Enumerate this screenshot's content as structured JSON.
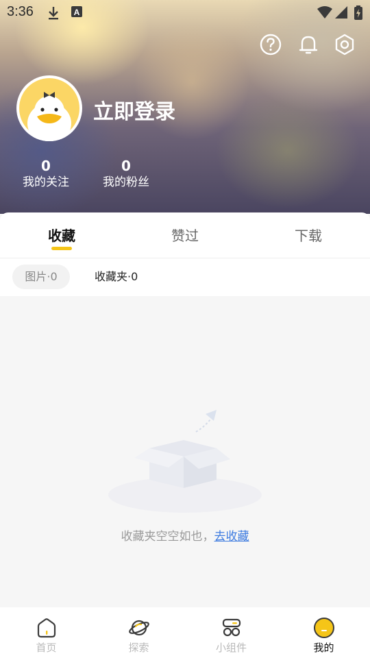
{
  "status_bar": {
    "time": "3:36",
    "left_icons": [
      "download-icon",
      "a-badge-icon"
    ],
    "right_icons": [
      "wifi-icon",
      "signal-icon",
      "battery-icon"
    ]
  },
  "header_actions": {
    "icons": [
      "help-icon",
      "bell-icon",
      "settings-icon"
    ]
  },
  "profile": {
    "avatar_icon": "duck-avatar-icon",
    "login_label": "立即登录",
    "stats": [
      {
        "value": "0",
        "label": "我的关注"
      },
      {
        "value": "0",
        "label": "我的粉丝"
      }
    ]
  },
  "tabs": [
    {
      "label": "收藏",
      "active": true
    },
    {
      "label": "赞过",
      "active": false
    },
    {
      "label": "下载",
      "active": false
    }
  ],
  "subtabs": [
    {
      "label": "图片·0",
      "active": true
    },
    {
      "label": "收藏夹·0",
      "active": false
    }
  ],
  "empty_state": {
    "illustration": "empty-box-icon",
    "message": "收藏夹空空如也，",
    "link_label": "去收藏"
  },
  "bottom_nav": [
    {
      "label": "首页",
      "icon": "home-icon",
      "active": false
    },
    {
      "label": "探索",
      "icon": "planet-icon",
      "active": false
    },
    {
      "label": "小组件",
      "icon": "widgets-icon",
      "active": false
    },
    {
      "label": "我的",
      "icon": "profile-icon",
      "active": true
    }
  ],
  "colors": {
    "accent": "#f5c518",
    "link": "#3d7be0"
  }
}
